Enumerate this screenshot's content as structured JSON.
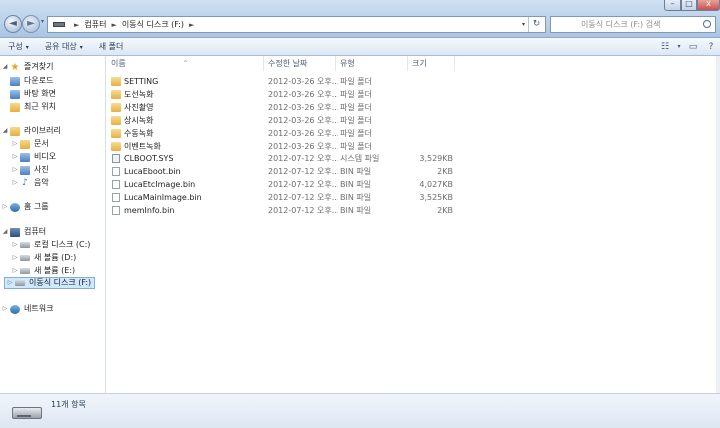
{
  "window": {
    "min_glyph": "–",
    "max_glyph": "□",
    "close_glyph": "x"
  },
  "nav": {
    "back_glyph": "◄",
    "forward_glyph": "►",
    "dropdown_glyph": "▾"
  },
  "address": {
    "crumbs": [
      "컴퓨터",
      "이동식 디스크 (F:)"
    ],
    "separator": "►",
    "dropdown_glyph": "▾",
    "refresh_glyph": "↻"
  },
  "search": {
    "placeholder": "이동식 디스크 (F:) 검색"
  },
  "toolbar": {
    "organize_label": "구성",
    "share_label": "공유 대상",
    "new_folder_label": "새 폴더",
    "caret": "▾",
    "view_icon_glyph": "☷",
    "view_caret": "▾",
    "preview_icon_glyph": "▭",
    "help_icon_glyph": "?"
  },
  "sidebar": {
    "favorites": {
      "label": "즐겨찾기",
      "items": [
        "다운로드",
        "바탕 화면",
        "최근 위치"
      ]
    },
    "libraries": {
      "label": "라이브러리",
      "items": [
        "문서",
        "비디오",
        "사진",
        "음악"
      ]
    },
    "homegroup": {
      "label": "홈 그룹"
    },
    "computer": {
      "label": "컴퓨터",
      "items": [
        "로컬 디스크 (C:)",
        "새 볼륨 (D:)",
        "새 볼륨 (E:)",
        "이동식 디스크 (F:)"
      ]
    },
    "network": {
      "label": "네트워크"
    },
    "expand_glyph": "▷",
    "expanded_glyph": "◢"
  },
  "columns": {
    "name": "이름",
    "date": "수정한 날짜",
    "type": "유형",
    "size": "크기",
    "sort_glyph": "^"
  },
  "files": [
    {
      "name": "SETTING",
      "date": "2012-03-26 오후...",
      "type": "파일 폴더",
      "size": "",
      "kind": "folder"
    },
    {
      "name": "도선녹화",
      "date": "2012-03-26 오후...",
      "type": "파일 폴더",
      "size": "",
      "kind": "folder"
    },
    {
      "name": "사진촬영",
      "date": "2012-03-26 오후...",
      "type": "파일 폴더",
      "size": "",
      "kind": "folder"
    },
    {
      "name": "상시녹화",
      "date": "2012-03-26 오후...",
      "type": "파일 폴더",
      "size": "",
      "kind": "folder"
    },
    {
      "name": "수동녹화",
      "date": "2012-03-26 오후...",
      "type": "파일 폴더",
      "size": "",
      "kind": "folder"
    },
    {
      "name": "이벤트녹화",
      "date": "2012-03-26 오후...",
      "type": "파일 폴더",
      "size": "",
      "kind": "folder"
    },
    {
      "name": "CLBOOT.SYS",
      "date": "2012-07-12 오후...",
      "type": "시스템 파일",
      "size": "3,529KB",
      "kind": "sys"
    },
    {
      "name": "LucaEboot.bin",
      "date": "2012-07-12 오후...",
      "type": "BIN 파일",
      "size": "2KB",
      "kind": "file"
    },
    {
      "name": "LucaEtcImage.bin",
      "date": "2012-07-12 오후...",
      "type": "BIN 파일",
      "size": "4,027KB",
      "kind": "file"
    },
    {
      "name": "LucaMainImage.bin",
      "date": "2012-07-12 오후...",
      "type": "BIN 파일",
      "size": "3,525KB",
      "kind": "file"
    },
    {
      "name": "memInfo.bin",
      "date": "2012-07-12 오후...",
      "type": "BIN 파일",
      "size": "2KB",
      "kind": "file"
    }
  ],
  "status": {
    "item_count": "11개 항목"
  }
}
